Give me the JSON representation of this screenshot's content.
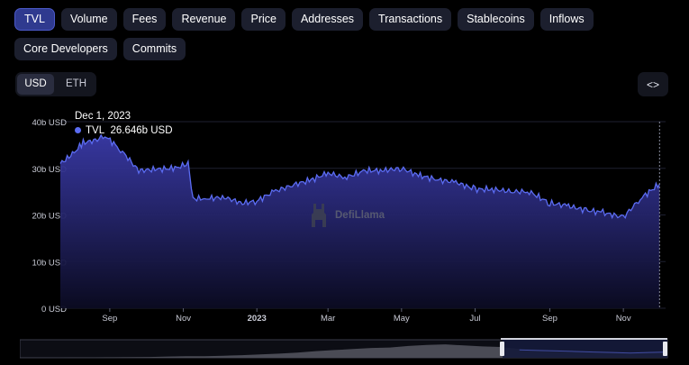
{
  "tabs": [
    {
      "label": "TVL",
      "active": true
    },
    {
      "label": "Volume",
      "active": false
    },
    {
      "label": "Fees",
      "active": false
    },
    {
      "label": "Revenue",
      "active": false
    },
    {
      "label": "Price",
      "active": false
    },
    {
      "label": "Addresses",
      "active": false
    },
    {
      "label": "Transactions",
      "active": false
    },
    {
      "label": "Stablecoins",
      "active": false
    },
    {
      "label": "Inflows",
      "active": false
    },
    {
      "label": "Core Developers",
      "active": false
    },
    {
      "label": "Commits",
      "active": false
    }
  ],
  "currency_toggle": {
    "options": [
      "USD",
      "ETH"
    ],
    "selected": "USD"
  },
  "embed_button": {
    "icon": "code-brackets-icon",
    "label": "<>"
  },
  "tooltip": {
    "date": "Dec 1, 2023",
    "series": "TVL",
    "value": "26.646b USD"
  },
  "watermark": {
    "text": "DefiLlama",
    "icon": "llama-logo-icon"
  },
  "colors": {
    "accent": "#5b6cf2",
    "area_top": "#3a3aa8",
    "area_bottom": "#0b0b22",
    "tab_active": "#2f3a8f"
  },
  "chart_data": {
    "type": "area",
    "series": [
      {
        "name": "TVL",
        "unit": "USD"
      }
    ],
    "x_ticks": [
      "Sep",
      "Nov",
      "2023",
      "Mar",
      "May",
      "Jul",
      "Sep",
      "Nov"
    ],
    "y_ticks": [
      "0 USD",
      "10b USD",
      "20b USD",
      "30b USD",
      "40b USD"
    ],
    "ylim": [
      0,
      40
    ],
    "x": [
      "2022-07-22",
      "2022-08-01",
      "2022-08-10",
      "2022-08-20",
      "2022-08-28",
      "2022-09-10",
      "2022-09-25",
      "2022-10-10",
      "2022-10-25",
      "2022-11-05",
      "2022-11-09",
      "2022-11-20",
      "2022-12-05",
      "2022-12-20",
      "2023-01-01",
      "2023-01-15",
      "2023-02-01",
      "2023-02-15",
      "2023-03-01",
      "2023-03-15",
      "2023-04-01",
      "2023-04-15",
      "2023-05-01",
      "2023-05-15",
      "2023-06-01",
      "2023-06-15",
      "2023-07-01",
      "2023-07-15",
      "2023-08-01",
      "2023-08-15",
      "2023-09-01",
      "2023-09-15",
      "2023-10-01",
      "2023-10-15",
      "2023-11-01",
      "2023-11-15",
      "2023-12-01"
    ],
    "values": [
      31.0,
      33.0,
      35.5,
      36.0,
      37.0,
      34.0,
      29.5,
      29.8,
      30.0,
      31.0,
      23.5,
      23.5,
      23.8,
      22.5,
      23.0,
      25.0,
      26.5,
      27.5,
      29.0,
      28.0,
      29.5,
      29.5,
      30.0,
      28.5,
      27.5,
      27.0,
      25.5,
      25.5,
      25.0,
      25.0,
      22.5,
      22.0,
      21.0,
      20.5,
      19.5,
      23.5,
      26.646
    ]
  },
  "range_slider": {
    "handle_label": "∥"
  }
}
